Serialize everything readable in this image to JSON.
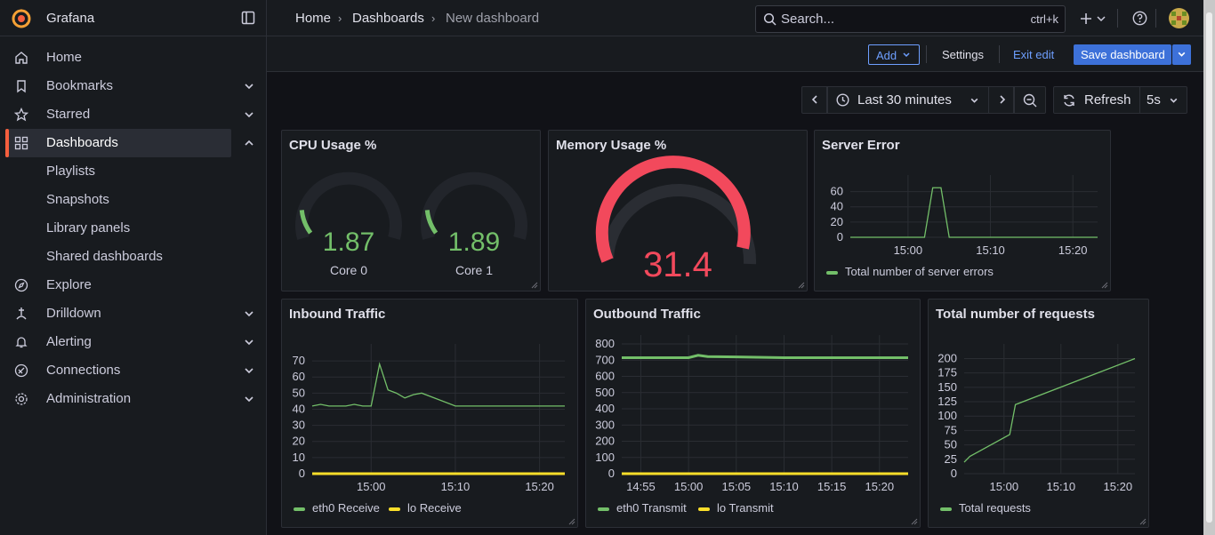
{
  "app": {
    "name": "Grafana"
  },
  "sidebar": {
    "items": [
      {
        "label": "Home",
        "icon": "home-icon"
      },
      {
        "label": "Bookmarks",
        "icon": "bookmark-icon"
      },
      {
        "label": "Starred",
        "icon": "star-icon"
      },
      {
        "label": "Dashboards",
        "icon": "dashboards-icon"
      },
      {
        "label": "Playlists"
      },
      {
        "label": "Snapshots"
      },
      {
        "label": "Library panels"
      },
      {
        "label": "Shared dashboards"
      },
      {
        "label": "Explore",
        "icon": "compass-icon"
      },
      {
        "label": "Drilldown",
        "icon": "drilldown-icon"
      },
      {
        "label": "Alerting",
        "icon": "bell-icon"
      },
      {
        "label": "Connections",
        "icon": "connections-icon"
      },
      {
        "label": "Administration",
        "icon": "gear-icon"
      }
    ]
  },
  "breadcrumb": {
    "home": "Home",
    "dashboards": "Dashboards",
    "current": "New dashboard"
  },
  "search": {
    "placeholder": "Search...",
    "shortcut": "ctrl+k"
  },
  "toolbar": {
    "add": "Add",
    "settings": "Settings",
    "exit_edit": "Exit edit",
    "save": "Save dashboard"
  },
  "time": {
    "range": "Last 30 minutes",
    "refresh": "Refresh",
    "interval": "5s"
  },
  "colors": {
    "green": "#73bf69",
    "yellow": "#fade2a",
    "red": "#f2495c",
    "accent": "#3d71d9",
    "brand": "#f55f3e"
  },
  "panels": {
    "cpu": {
      "title": "CPU Usage %",
      "gauges": [
        {
          "value": "1.87",
          "label": "Core 0",
          "fraction": 0.0187
        },
        {
          "value": "1.89",
          "label": "Core 1",
          "fraction": 0.0189
        }
      ]
    },
    "memory": {
      "title": "Memory Usage %",
      "value": "31.4"
    },
    "server_error": {
      "title": "Server Error",
      "legend": "Total number of server errors"
    },
    "inbound": {
      "title": "Inbound Traffic",
      "legend": [
        "eth0 Receive",
        "lo Receive"
      ]
    },
    "outbound": {
      "title": "Outbound Traffic",
      "legend": [
        "eth0 Transmit",
        "lo Transmit"
      ]
    },
    "requests": {
      "title": "Total number of requests",
      "legend": "Total requests"
    }
  },
  "chart_data": [
    {
      "type": "line",
      "title": "Server Error",
      "x": [
        "14:53",
        "14:58",
        "15:00",
        "15:02",
        "15:03",
        "15:04",
        "15:05",
        "15:10",
        "15:15",
        "15:20",
        "15:23"
      ],
      "xticks": [
        "15:00",
        "15:10",
        "15:20"
      ],
      "yticks": [
        0,
        20,
        40,
        60
      ],
      "ylim": [
        0,
        70
      ],
      "series": [
        {
          "name": "Total number of server errors",
          "values": [
            0,
            0,
            0,
            0,
            65,
            65,
            0,
            0,
            0,
            0,
            0
          ]
        }
      ]
    },
    {
      "type": "line",
      "title": "Inbound Traffic",
      "x": [
        "14:53",
        "14:54",
        "14:55",
        "14:56",
        "14:57",
        "14:58",
        "14:59",
        "15:00",
        "15:01",
        "15:02",
        "15:03",
        "15:04",
        "15:05",
        "15:06",
        "15:10",
        "15:15",
        "15:20",
        "15:23"
      ],
      "xticks": [
        "15:00",
        "15:10",
        "15:20"
      ],
      "yticks": [
        0,
        10,
        20,
        30,
        40,
        50,
        60,
        70
      ],
      "ylim": [
        0,
        75
      ],
      "series": [
        {
          "name": "eth0 Receive",
          "values": [
            42,
            43,
            42,
            42,
            42,
            43,
            42,
            42,
            68,
            52,
            50,
            47,
            49,
            50,
            42,
            42,
            42,
            42
          ]
        },
        {
          "name": "lo Receive",
          "values": [
            0,
            0,
            0,
            0,
            0,
            0,
            0,
            0,
            0,
            0,
            0,
            0,
            0,
            0,
            0,
            0,
            0,
            0
          ]
        }
      ]
    },
    {
      "type": "line",
      "title": "Outbound Traffic",
      "xticks": [
        "14:55",
        "15:00",
        "15:05",
        "15:10",
        "15:15",
        "15:20"
      ],
      "x": [
        "14:53",
        "14:55",
        "15:00",
        "15:01",
        "15:02",
        "15:05",
        "15:10",
        "15:15",
        "15:20",
        "15:23"
      ],
      "yticks": [
        0,
        100,
        200,
        300,
        400,
        500,
        600,
        700,
        800
      ],
      "ylim": [
        0,
        800
      ],
      "series": [
        {
          "name": "eth0 Transmit",
          "values": [
            715,
            715,
            715,
            730,
            722,
            720,
            715,
            715,
            715,
            715
          ]
        },
        {
          "name": "lo Transmit",
          "values": [
            0,
            0,
            0,
            0,
            0,
            0,
            0,
            0,
            0,
            0
          ]
        }
      ]
    },
    {
      "type": "line",
      "title": "Total number of requests",
      "x": [
        "14:53",
        "14:54",
        "15:01",
        "15:02",
        "15:23"
      ],
      "xticks": [
        "15:00",
        "15:10",
        "15:20"
      ],
      "yticks": [
        0,
        25,
        50,
        75,
        100,
        125,
        150,
        175,
        200
      ],
      "ylim": [
        0,
        210
      ],
      "series": [
        {
          "name": "Total requests",
          "values": [
            20,
            30,
            68,
            120,
            200
          ]
        }
      ]
    }
  ]
}
